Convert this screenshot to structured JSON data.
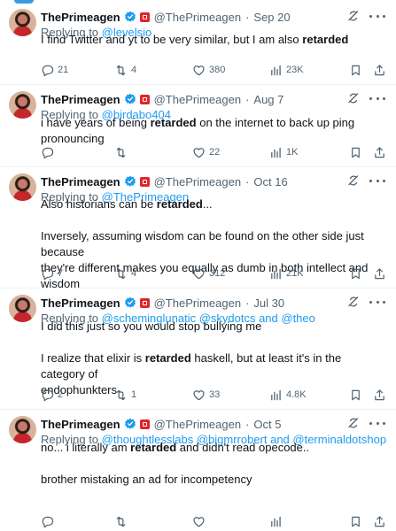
{
  "author": {
    "display_name": "ThePrimeagen",
    "handle": "@ThePrimeagen"
  },
  "tweets": [
    {
      "date": "Sep 20",
      "replying_prefix": "Replying to",
      "replying_to": "@levelsio",
      "lines": [
        [
          "I find Twitter and yt to be very similar, but I am also ",
          "retarded",
          ""
        ]
      ],
      "replies": "21",
      "retweets": "4",
      "likes": "380",
      "views": "23K"
    },
    {
      "date": "Aug 7",
      "replying_prefix": "Replying to",
      "replying_to": "@birdabo404",
      "lines": [
        [
          "i have years of being ",
          "retarded",
          " on the internet to back up ping pronouncing"
        ]
      ],
      "replies": "",
      "retweets": "",
      "likes": "22",
      "views": "1K"
    },
    {
      "date": "Oct 16",
      "replying_prefix": "Replying to",
      "replying_to": "@ThePrimeagen",
      "lines": [
        [
          "Also historians can be ",
          "retarded",
          "..."
        ],
        [
          "",
          "",
          ""
        ],
        [
          "Inversely, assuming wisdom can be found on the other side just because",
          "",
          ""
        ],
        [
          "they're different makes you equally as dumb in both intellect and wisdom",
          "",
          ""
        ]
      ],
      "replies": "7",
      "retweets": "4",
      "likes": "312",
      "views": "21K"
    },
    {
      "date": "Jul 30",
      "replying_prefix": "Replying to",
      "replying_to": "@scheminglunatic @skydotcs and @theo",
      "lines": [
        [
          "I did this just so you would stop bullying me",
          "",
          ""
        ],
        [
          "",
          "",
          ""
        ],
        [
          "I realize that elixir is ",
          "retarded",
          " haskell, but at least it's in the category of"
        ],
        [
          "endophunkters",
          "",
          ""
        ]
      ],
      "replies": "2",
      "retweets": "1",
      "likes": "33",
      "views": "4.8K"
    },
    {
      "date": "Oct 5",
      "replying_prefix": "Replying to",
      "replying_to": "@thoughtlesslabs @bigmrrobert and @terminaldotshop",
      "lines": [
        [
          "no... i literally am ",
          "retarded",
          " and didn't read opecode.."
        ],
        [
          "",
          "",
          ""
        ],
        [
          "brother mistaking an ad for incompetency",
          "",
          ""
        ]
      ],
      "replies": "",
      "retweets": "",
      "likes": "",
      "views": ""
    }
  ],
  "icons": {
    "reply": "comment-icon",
    "retweet": "retweet-icon",
    "like": "heart-icon",
    "views": "analytics-icon",
    "bookmark": "bookmark-icon",
    "share": "share-icon",
    "grok": "grok-icon",
    "more": "more-icon"
  },
  "colors": {
    "accent": "#1d9bf0",
    "text": "#0f1419",
    "muted": "#536471",
    "verified": "#1d9bf0"
  }
}
